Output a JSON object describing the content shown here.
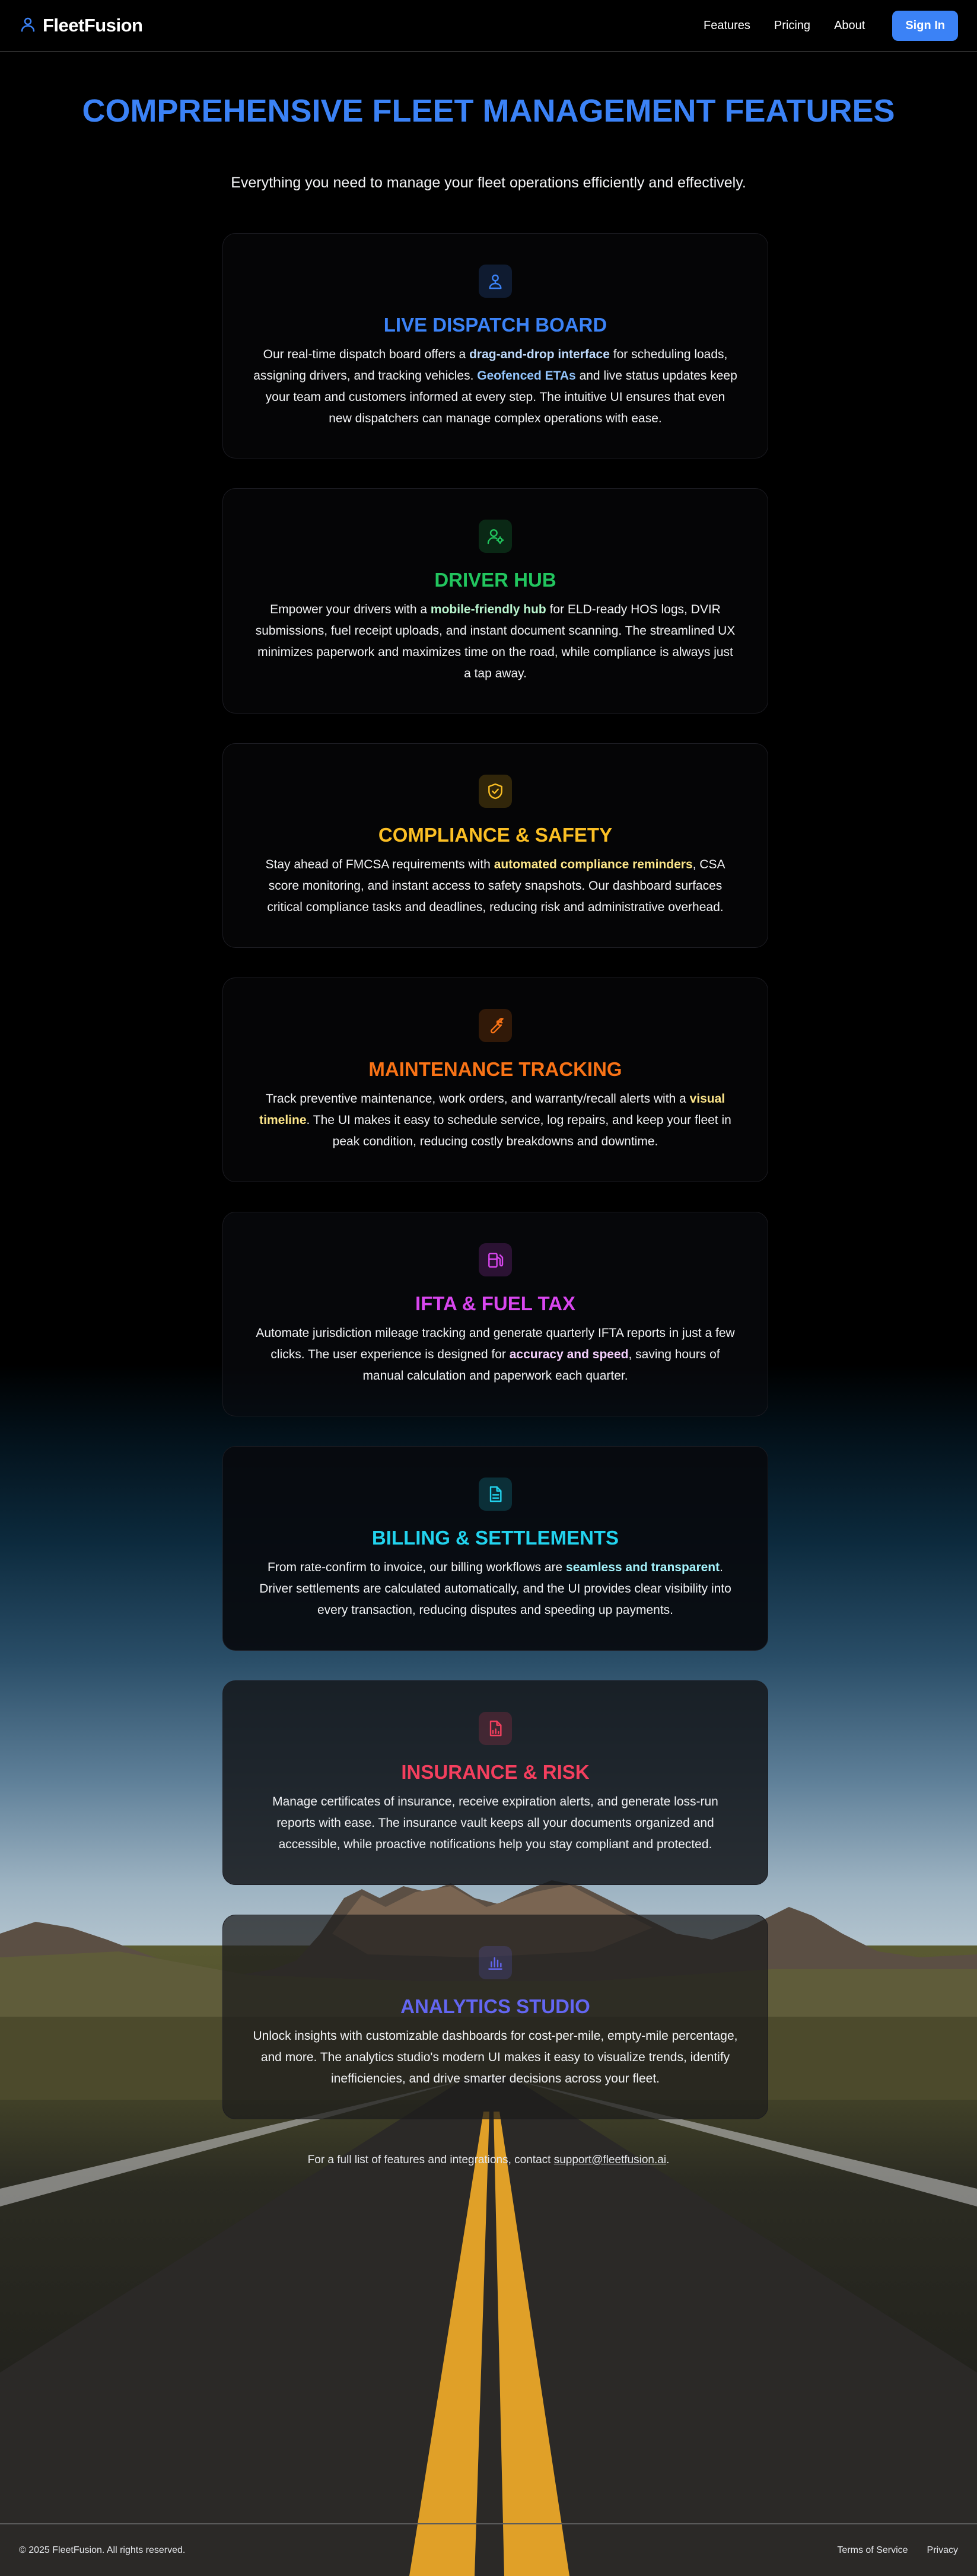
{
  "colors": {
    "primary": "#3b82f6",
    "green": "#22c55e",
    "yellow": "#fbbf24",
    "orange": "#f97316",
    "magenta": "#d946ef",
    "cyan": "#22d3ee",
    "rose": "#f43f5e",
    "indigo": "#6366f1"
  },
  "header": {
    "brand": "FleetFusion",
    "brand_icon": "user-pin-icon",
    "nav": [
      "Features",
      "Pricing",
      "About"
    ],
    "signin_label": "Sign In"
  },
  "hero": {
    "title": "Comprehensive Fleet Management Features",
    "subtitle": "Everything you need to manage your fleet operations efficiently and effectively."
  },
  "features": [
    {
      "icon": "map-pin-icon",
      "color": "#3b82f6",
      "title": "Live Dispatch Board",
      "text": [
        {
          "t": "Our real-time dispatch board offers a "
        },
        {
          "t": "drag-and-drop interface",
          "hl": true
        },
        {
          "t": " for scheduling loads, assigning drivers, and tracking vehicles. "
        },
        {
          "t": "Geofenced ETAs",
          "hl": true,
          "light": true
        },
        {
          "t": " and live status updates keep your team and customers informed at every step. The intuitive UI ensures that even new dispatchers can manage complex operations with ease."
        }
      ]
    },
    {
      "icon": "user-gear-icon",
      "color": "#22c55e",
      "title": "Driver Hub",
      "text": [
        {
          "t": "Empower your drivers with a "
        },
        {
          "t": "mobile-friendly hub",
          "hl": true
        },
        {
          "t": " for ELD-ready HOS logs, DVIR submissions, fuel receipt uploads, and instant document scanning. The streamlined UX minimizes paperwork and maximizes time on the road, while compliance is always just a tap away."
        }
      ]
    },
    {
      "icon": "shield-check-icon",
      "color": "#fbbf24",
      "title": "Compliance & Safety",
      "text": [
        {
          "t": "Stay ahead of FMCSA requirements with "
        },
        {
          "t": "automated compliance reminders",
          "hl": true
        },
        {
          "t": ", CSA score monitoring, and instant access to safety snapshots. Our dashboard surfaces critical compliance tasks and deadlines, reducing risk and administrative overhead."
        }
      ]
    },
    {
      "icon": "wrench-icon",
      "color": "#f97316",
      "title": "Maintenance Tracking",
      "text": [
        {
          "t": "Track preventive maintenance, work orders, and warranty/recall alerts with a "
        },
        {
          "t": "visual timeline",
          "hl": true
        },
        {
          "t": ". The UI makes it easy to schedule service, log repairs, and keep your fleet in peak condition, reducing costly breakdowns and downtime."
        }
      ]
    },
    {
      "icon": "fuel-pump-icon",
      "color": "#d946ef",
      "title": "IFTA & Fuel Tax",
      "text": [
        {
          "t": "Automate jurisdiction mileage tracking and generate quarterly IFTA reports in just a few clicks. The user experience is designed for "
        },
        {
          "t": "accuracy and speed",
          "hl": true
        },
        {
          "t": ", saving hours of manual calculation and paperwork each quarter."
        }
      ]
    },
    {
      "icon": "document-icon",
      "color": "#22d3ee",
      "title": "Billing & Settlements",
      "text": [
        {
          "t": "From rate-confirm to invoice, our billing workflows are "
        },
        {
          "t": "seamless and transparent",
          "hl": true
        },
        {
          "t": ". Driver settlements are calculated automatically, and the UI provides clear visibility into every transaction, reducing disputes and speeding up payments."
        }
      ]
    },
    {
      "icon": "report-icon",
      "color": "#f43f5e",
      "title": "Insurance & Risk",
      "text": [
        {
          "t": "Manage certificates of insurance, receive expiration alerts, and generate loss-run reports with ease. The insurance vault keeps all your documents organized and accessible, while proactive notifications help you stay compliant and protected."
        }
      ]
    },
    {
      "icon": "bar-chart-icon",
      "color": "#6366f1",
      "title": "Analytics Studio",
      "text": [
        {
          "t": "Unlock insights with customizable dashboards for cost-per-mile, empty-mile percentage, and more. The analytics studio's modern UI makes it easy to visualize trends, identify inefficiencies, and drive smarter decisions across your fleet."
        }
      ]
    }
  ],
  "footnote": {
    "prefix": "For a full list of features and integrations, contact ",
    "email": "support@fleetfusion.ai",
    "suffix": "."
  },
  "footer": {
    "copyright": "© 2025 FleetFusion. All rights reserved.",
    "links": [
      "Terms of Service",
      "Privacy"
    ]
  }
}
